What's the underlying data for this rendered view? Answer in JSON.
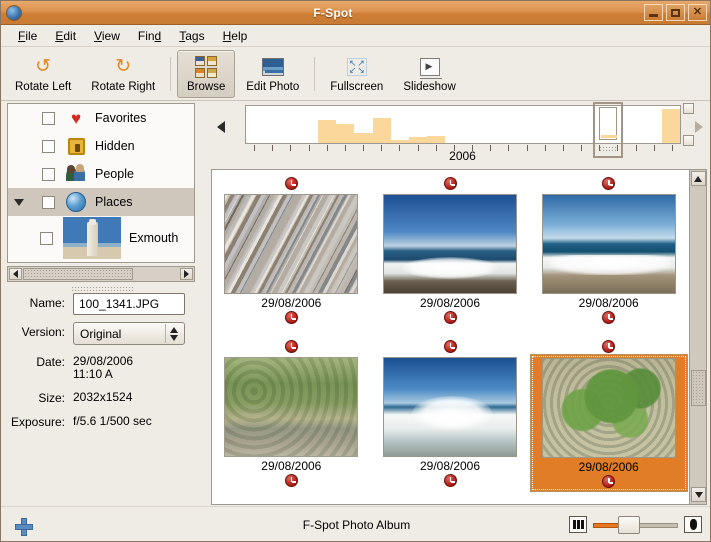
{
  "window": {
    "title": "F-Spot",
    "icon": "fspot-app-icon",
    "buttons": [
      {
        "name": "minimize",
        "glyph": "_"
      },
      {
        "name": "maximize",
        "glyph": "□"
      },
      {
        "name": "close",
        "glyph": "✕"
      }
    ]
  },
  "menubar": {
    "items": [
      "File",
      "Edit",
      "View",
      "Find",
      "Tags",
      "Help"
    ]
  },
  "toolbar": {
    "items": [
      {
        "label": "Rotate Left",
        "icon": "rotate-left-icon",
        "active": false
      },
      {
        "label": "Rotate Right",
        "icon": "rotate-right-icon",
        "active": false
      },
      {
        "label": "Browse",
        "icon": "browse-grid-icon",
        "active": true
      },
      {
        "label": "Edit Photo",
        "icon": "edit-photo-icon",
        "active": false
      },
      {
        "label": "Fullscreen",
        "icon": "fullscreen-icon",
        "active": false
      },
      {
        "label": "Slideshow",
        "icon": "slideshow-icon",
        "active": false
      }
    ]
  },
  "sidebar": {
    "tags": [
      {
        "label": "Favorites",
        "icon": "heart-icon",
        "checked": false,
        "selected": false,
        "expandable": false,
        "child": false
      },
      {
        "label": "Hidden",
        "icon": "lock-icon",
        "checked": false,
        "selected": false,
        "expandable": false,
        "child": false
      },
      {
        "label": "People",
        "icon": "people-icon",
        "checked": false,
        "selected": false,
        "expandable": false,
        "child": false
      },
      {
        "label": "Places",
        "icon": "globe-icon",
        "checked": false,
        "selected": true,
        "expandable": true,
        "child": false
      },
      {
        "label": "Exmouth",
        "icon": "lighthouse-thumbnail",
        "checked": false,
        "selected": false,
        "expandable": false,
        "child": true
      }
    ]
  },
  "metadata": {
    "name_label": "Name:",
    "name_value": "100_1341.JPG",
    "name_placeholder": "File name",
    "version_label": "Version:",
    "version_value": "Original",
    "version_options": [
      "Original"
    ],
    "date_label": "Date:",
    "date_value_line1": "29/08/2006",
    "date_value_line2": "11:10 A",
    "size_label": "Size:",
    "size_value": "2032x1524",
    "exposure_label": "Exposure:",
    "exposure_value": "f/5.6 1/500 sec"
  },
  "timeline": {
    "year_label": "2006",
    "prev_icon": "left-arrow-icon",
    "next_icon": "right-arrow-icon",
    "selector_name": "timeline-selector-handle",
    "bars": [
      0,
      0,
      0,
      0,
      38,
      31,
      17,
      40,
      5,
      10,
      11,
      0,
      0,
      0,
      0,
      0,
      0,
      0,
      0,
      0,
      0,
      0,
      0,
      55
    ],
    "tick_count": 24
  },
  "photos": {
    "rows": [
      [
        {
          "caption": "29/08/2006",
          "style": "ph-rock",
          "alt": "rock-strata-photo",
          "selected": false
        },
        {
          "caption": "29/08/2006",
          "style": "ph-wave1",
          "alt": "ocean-wave-photo",
          "selected": false
        },
        {
          "caption": "29/08/2006",
          "style": "ph-shore",
          "alt": "rocky-shoreline-photo",
          "selected": false
        }
      ],
      [
        {
          "caption": "29/08/2006",
          "style": "ph-veg",
          "alt": "coastal-vegetation-photo",
          "selected": false
        },
        {
          "caption": "29/08/2006",
          "style": "ph-wave2",
          "alt": "breaking-wave-photo",
          "selected": false
        },
        {
          "caption": "29/08/2006",
          "style": "ph-plant",
          "alt": "green-succulent-photo",
          "selected": true
        }
      ]
    ],
    "badge_icon": "clock-icon"
  },
  "statusbar": {
    "add_icon": "add-plus-icon",
    "text": "F-Spot Photo Album",
    "zoom_small_icon": "small-thumbnails-icon",
    "zoom_large_icon": "large-thumbnail-icon"
  },
  "colors": {
    "titlebar_orange": "#dd9350",
    "selection_orange": "#e07d26",
    "histogram_bar": "#fbd79b",
    "panel_bg": "#efebe5"
  }
}
